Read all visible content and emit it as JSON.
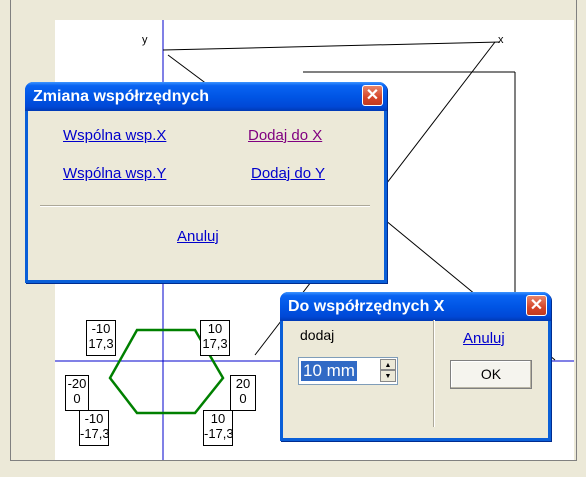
{
  "drawing": {
    "axis_labels": {
      "y": "y",
      "x": "x"
    },
    "coord_boxes": [
      {
        "top": "-10",
        "bottom": "17,3"
      },
      {
        "top": "10",
        "bottom": "17,3"
      },
      {
        "top": "-20",
        "bottom": "0"
      },
      {
        "top": "20",
        "bottom": "0"
      },
      {
        "top": "-10",
        "bottom": "-17,3"
      },
      {
        "top": "10",
        "bottom": "-17,3"
      }
    ]
  },
  "change_dialog": {
    "title": "Zmiana współrzędnych",
    "links": {
      "common_x": "Wspólna wsp.X",
      "add_to_x": "Dodaj do X",
      "common_y": "Wspólna wsp.Y",
      "add_to_y": "Dodaj do Y",
      "cancel": "Anuluj"
    }
  },
  "add_x_dialog": {
    "title": "Do współrzędnych X",
    "field_label": "dodaj",
    "field_value": "10 mm",
    "cancel": "Anuluj",
    "ok": "OK"
  }
}
